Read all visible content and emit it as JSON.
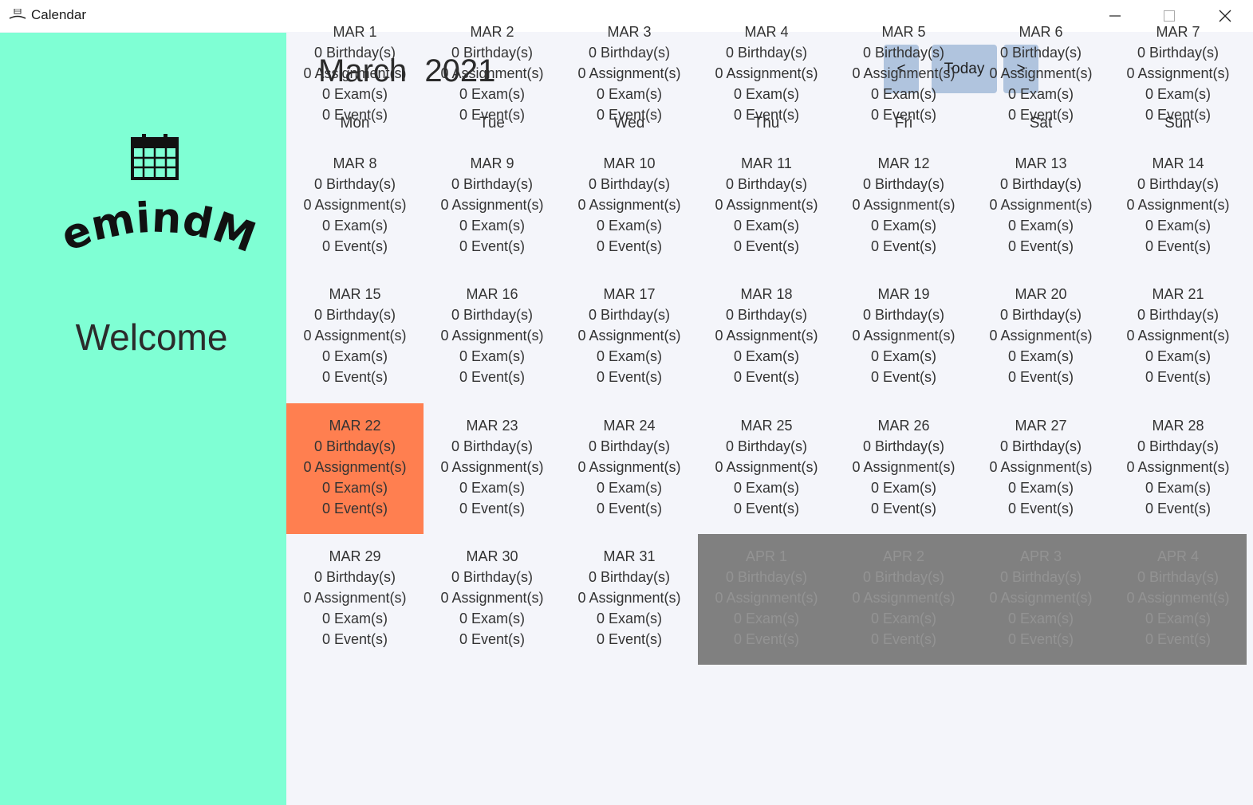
{
  "window": {
    "title": "Calendar",
    "minimize_glyph": "—",
    "maximize_glyph": "☐",
    "close_glyph": "✕"
  },
  "sidebar": {
    "logo_text": "RemindMe",
    "welcome": "Welcome",
    "bg_color": "#7fffd4"
  },
  "header": {
    "month": "March",
    "year": "2021",
    "prev_label": "<",
    "today_label": "Today",
    "next_label": ">"
  },
  "weekdays": [
    "Mon",
    "Tue",
    "Wed",
    "Thu",
    "Fri",
    "Sat",
    "Sun"
  ],
  "colors": {
    "today_bg": "#ff7f50",
    "other_month_bg": "#808080",
    "button_bg": "#b0c4de",
    "main_bg": "#f4f5fa"
  },
  "days": [
    {
      "date": "MAR 1",
      "birthdays": "0 Birthday(s)",
      "assignments": "0 Assignment(s)",
      "exams": "0 Exam(s)",
      "events": "0 Event(s)",
      "state": "normal"
    },
    {
      "date": "MAR 2",
      "birthdays": "0 Birthday(s)",
      "assignments": "0 Assignment(s)",
      "exams": "0 Exam(s)",
      "events": "0 Event(s)",
      "state": "normal"
    },
    {
      "date": "MAR 3",
      "birthdays": "0 Birthday(s)",
      "assignments": "0 Assignment(s)",
      "exams": "0 Exam(s)",
      "events": "0 Event(s)",
      "state": "normal"
    },
    {
      "date": "MAR 4",
      "birthdays": "0 Birthday(s)",
      "assignments": "0 Assignment(s)",
      "exams": "0 Exam(s)",
      "events": "0 Event(s)",
      "state": "normal"
    },
    {
      "date": "MAR 5",
      "birthdays": "0 Birthday(s)",
      "assignments": "0 Assignment(s)",
      "exams": "0 Exam(s)",
      "events": "0 Event(s)",
      "state": "normal"
    },
    {
      "date": "MAR 6",
      "birthdays": "0 Birthday(s)",
      "assignments": "0 Assignment(s)",
      "exams": "0 Exam(s)",
      "events": "0 Event(s)",
      "state": "normal"
    },
    {
      "date": "MAR 7",
      "birthdays": "0 Birthday(s)",
      "assignments": "0 Assignment(s)",
      "exams": "0 Exam(s)",
      "events": "0 Event(s)",
      "state": "normal"
    },
    {
      "date": "MAR 8",
      "birthdays": "0 Birthday(s)",
      "assignments": "0 Assignment(s)",
      "exams": "0 Exam(s)",
      "events": "0 Event(s)",
      "state": "normal"
    },
    {
      "date": "MAR 9",
      "birthdays": "0 Birthday(s)",
      "assignments": "0 Assignment(s)",
      "exams": "0 Exam(s)",
      "events": "0 Event(s)",
      "state": "normal"
    },
    {
      "date": "MAR 10",
      "birthdays": "0 Birthday(s)",
      "assignments": "0 Assignment(s)",
      "exams": "0 Exam(s)",
      "events": "0 Event(s)",
      "state": "normal"
    },
    {
      "date": "MAR 11",
      "birthdays": "0 Birthday(s)",
      "assignments": "0 Assignment(s)",
      "exams": "0 Exam(s)",
      "events": "0 Event(s)",
      "state": "normal"
    },
    {
      "date": "MAR 12",
      "birthdays": "0 Birthday(s)",
      "assignments": "0 Assignment(s)",
      "exams": "0 Exam(s)",
      "events": "0 Event(s)",
      "state": "normal"
    },
    {
      "date": "MAR 13",
      "birthdays": "0 Birthday(s)",
      "assignments": "0 Assignment(s)",
      "exams": "0 Exam(s)",
      "events": "0 Event(s)",
      "state": "normal"
    },
    {
      "date": "MAR 14",
      "birthdays": "0 Birthday(s)",
      "assignments": "0 Assignment(s)",
      "exams": "0 Exam(s)",
      "events": "0 Event(s)",
      "state": "normal"
    },
    {
      "date": "MAR 15",
      "birthdays": "0 Birthday(s)",
      "assignments": "0 Assignment(s)",
      "exams": "0 Exam(s)",
      "events": "0 Event(s)",
      "state": "normal"
    },
    {
      "date": "MAR 16",
      "birthdays": "0 Birthday(s)",
      "assignments": "0 Assignment(s)",
      "exams": "0 Exam(s)",
      "events": "0 Event(s)",
      "state": "normal"
    },
    {
      "date": "MAR 17",
      "birthdays": "0 Birthday(s)",
      "assignments": "0 Assignment(s)",
      "exams": "0 Exam(s)",
      "events": "0 Event(s)",
      "state": "normal"
    },
    {
      "date": "MAR 18",
      "birthdays": "0 Birthday(s)",
      "assignments": "0 Assignment(s)",
      "exams": "0 Exam(s)",
      "events": "0 Event(s)",
      "state": "normal"
    },
    {
      "date": "MAR 19",
      "birthdays": "0 Birthday(s)",
      "assignments": "0 Assignment(s)",
      "exams": "0 Exam(s)",
      "events": "0 Event(s)",
      "state": "normal"
    },
    {
      "date": "MAR 20",
      "birthdays": "0 Birthday(s)",
      "assignments": "0 Assignment(s)",
      "exams": "0 Exam(s)",
      "events": "0 Event(s)",
      "state": "normal"
    },
    {
      "date": "MAR 21",
      "birthdays": "0 Birthday(s)",
      "assignments": "0 Assignment(s)",
      "exams": "0 Exam(s)",
      "events": "0 Event(s)",
      "state": "normal"
    },
    {
      "date": "MAR 22",
      "birthdays": "0 Birthday(s)",
      "assignments": "0 Assignment(s)",
      "exams": "0 Exam(s)",
      "events": "0 Event(s)",
      "state": "today"
    },
    {
      "date": "MAR 23",
      "birthdays": "0 Birthday(s)",
      "assignments": "0 Assignment(s)",
      "exams": "0 Exam(s)",
      "events": "0 Event(s)",
      "state": "normal"
    },
    {
      "date": "MAR 24",
      "birthdays": "0 Birthday(s)",
      "assignments": "0 Assignment(s)",
      "exams": "0 Exam(s)",
      "events": "0 Event(s)",
      "state": "normal"
    },
    {
      "date": "MAR 25",
      "birthdays": "0 Birthday(s)",
      "assignments": "0 Assignment(s)",
      "exams": "0 Exam(s)",
      "events": "0 Event(s)",
      "state": "normal"
    },
    {
      "date": "MAR 26",
      "birthdays": "0 Birthday(s)",
      "assignments": "0 Assignment(s)",
      "exams": "0 Exam(s)",
      "events": "0 Event(s)",
      "state": "normal"
    },
    {
      "date": "MAR 27",
      "birthdays": "0 Birthday(s)",
      "assignments": "0 Assignment(s)",
      "exams": "0 Exam(s)",
      "events": "0 Event(s)",
      "state": "normal"
    },
    {
      "date": "MAR 28",
      "birthdays": "0 Birthday(s)",
      "assignments": "0 Assignment(s)",
      "exams": "0 Exam(s)",
      "events": "0 Event(s)",
      "state": "normal"
    },
    {
      "date": "MAR 29",
      "birthdays": "0 Birthday(s)",
      "assignments": "0 Assignment(s)",
      "exams": "0 Exam(s)",
      "events": "0 Event(s)",
      "state": "normal"
    },
    {
      "date": "MAR 30",
      "birthdays": "0 Birthday(s)",
      "assignments": "0 Assignment(s)",
      "exams": "0 Exam(s)",
      "events": "0 Event(s)",
      "state": "normal"
    },
    {
      "date": "MAR 31",
      "birthdays": "0 Birthday(s)",
      "assignments": "0 Assignment(s)",
      "exams": "0 Exam(s)",
      "events": "0 Event(s)",
      "state": "normal"
    },
    {
      "date": "APR 1",
      "birthdays": "0 Birthday(s)",
      "assignments": "0 Assignment(s)",
      "exams": "0 Exam(s)",
      "events": "0 Event(s)",
      "state": "other"
    },
    {
      "date": "APR 2",
      "birthdays": "0 Birthday(s)",
      "assignments": "0 Assignment(s)",
      "exams": "0 Exam(s)",
      "events": "0 Event(s)",
      "state": "other"
    },
    {
      "date": "APR 3",
      "birthdays": "0 Birthday(s)",
      "assignments": "0 Assignment(s)",
      "exams": "0 Exam(s)",
      "events": "0 Event(s)",
      "state": "other"
    },
    {
      "date": "APR 4",
      "birthdays": "0 Birthday(s)",
      "assignments": "0 Assignment(s)",
      "exams": "0 Exam(s)",
      "events": "0 Event(s)",
      "state": "other"
    }
  ]
}
